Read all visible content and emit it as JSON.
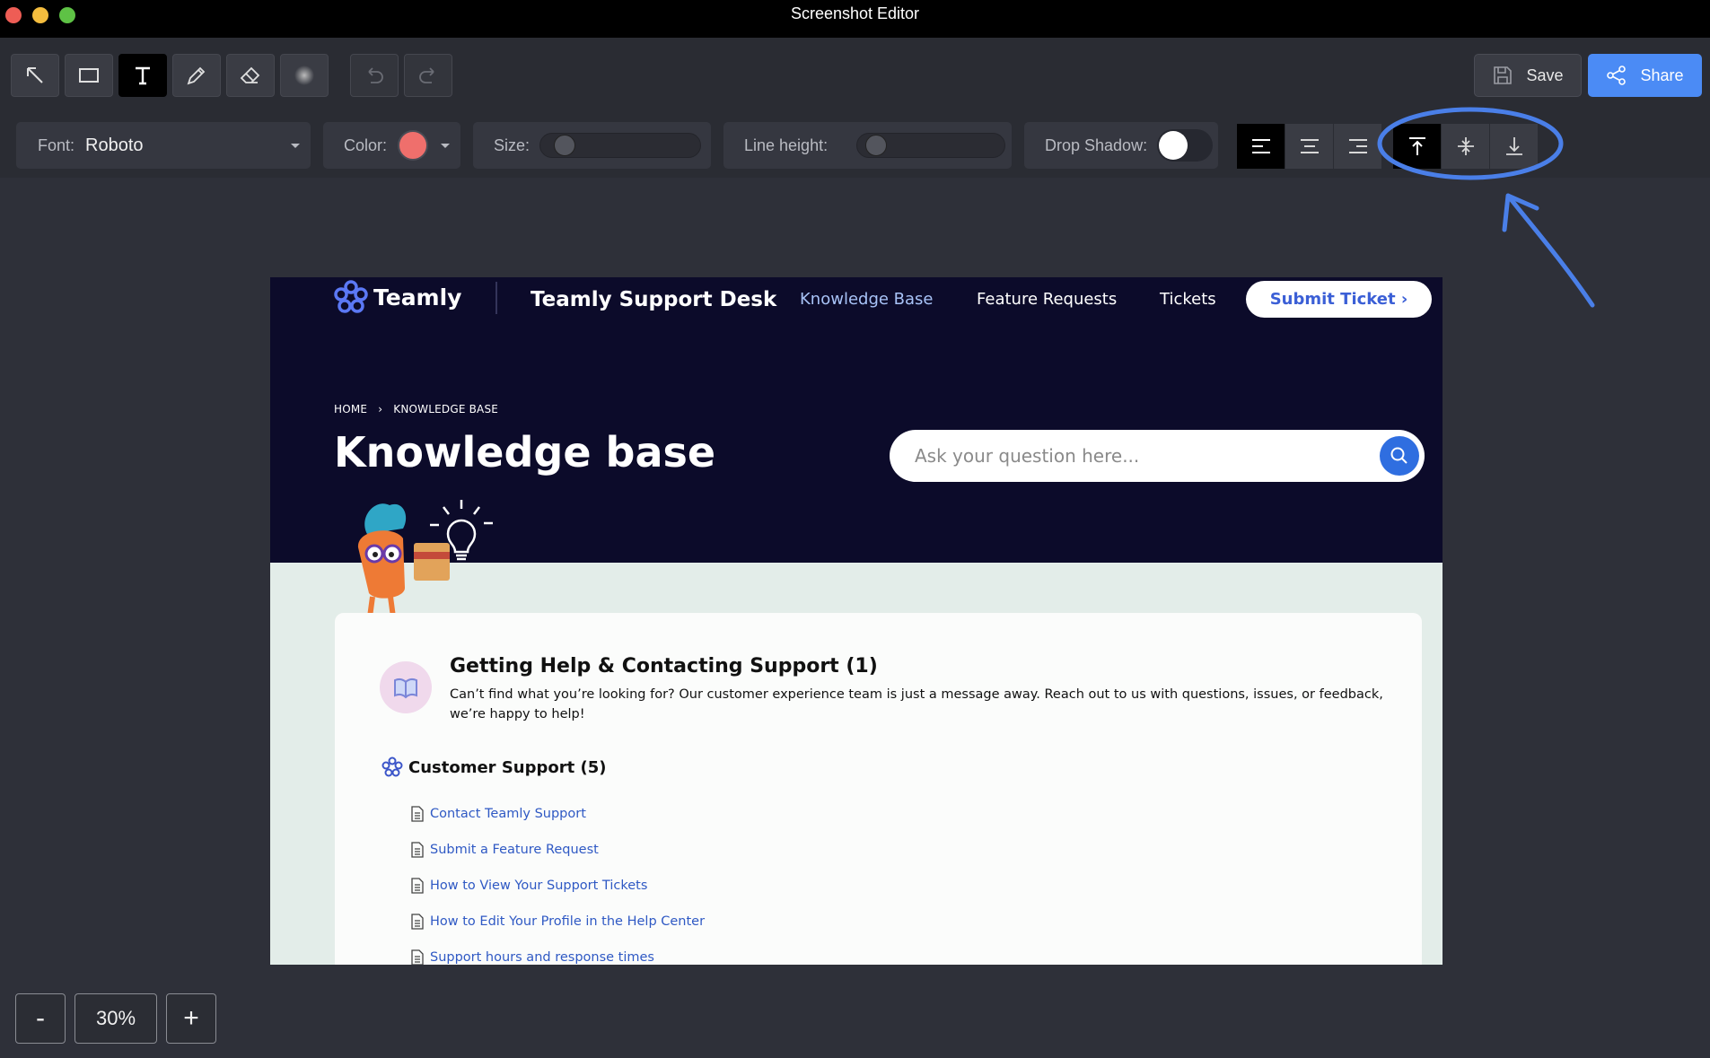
{
  "window": {
    "title": "Screenshot Editor"
  },
  "toolbar": {
    "save_label": "Save",
    "share_label": "Share",
    "tools": [
      "arrow-tool",
      "rectangle-tool",
      "text-tool",
      "pencil-tool",
      "eraser-tool",
      "blur-tool"
    ],
    "active_tool": "text-tool"
  },
  "text_options": {
    "font_label": "Font:",
    "font_value": "Roboto",
    "color_label": "Color:",
    "color_value": "#ef6f6c",
    "size_label": "Size:",
    "line_height_label": "Line height:",
    "drop_shadow_label": "Drop Shadow:",
    "drop_shadow_on": false,
    "horizontal_align_active": "left",
    "vertical_align_active": "top"
  },
  "zoom": {
    "minus": "-",
    "value": "30%",
    "plus": "+"
  },
  "site": {
    "brand": "Teamly",
    "desk_title": "Teamly Support Desk",
    "nav": [
      "Knowledge Base",
      "Feature Requests",
      "Tickets"
    ],
    "submit_label": "Submit Ticket ›",
    "breadcrumb_home": "HOME",
    "breadcrumb_sep": "›",
    "breadcrumb_current": "KNOWLEDGE BASE",
    "page_title": "Knowledge base",
    "search_placeholder": "Ask your question here...",
    "section": {
      "title": "Getting Help & Contacting Support (1)",
      "description": "Can’t find what you’re looking for? Our customer experience team is just a message away. Reach out to us with questions, issues, or feedback, we’re happy to help!"
    },
    "category": {
      "title": "Customer Support (5)",
      "articles": [
        "Contact Teamly Support",
        "Submit a Feature Request",
        "How to View Your Support Tickets",
        "How to Edit Your Profile in the Help Center",
        "Support hours and response times"
      ]
    }
  },
  "colors": {
    "accent": "#4b8bf5",
    "annotation": "#4a7fe8",
    "canvas_dark": "#0c0b2a"
  }
}
